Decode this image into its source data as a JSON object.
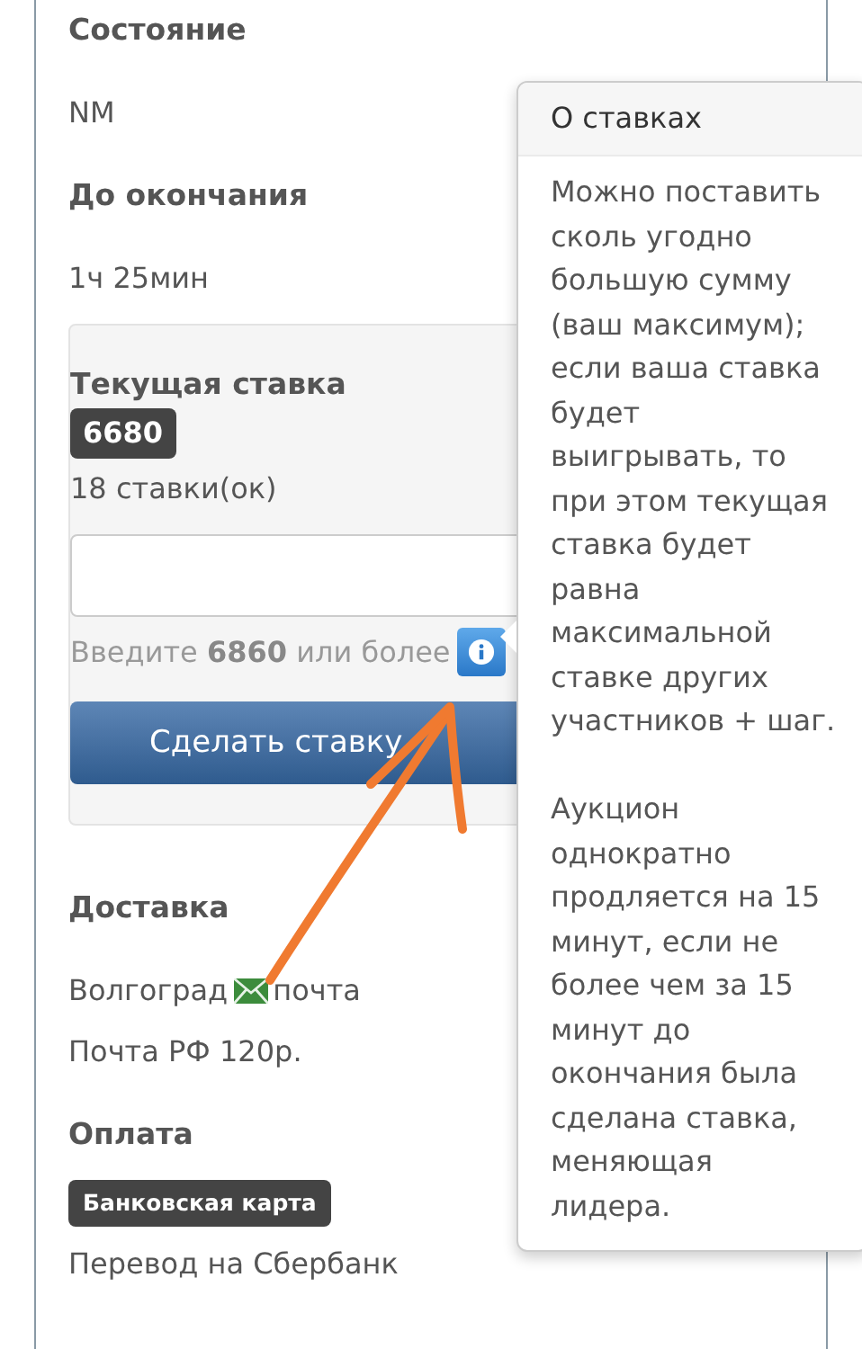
{
  "fields": [
    {
      "label": "Состояние",
      "value": "NM"
    },
    {
      "label": "До окончания",
      "value": "1ч 25мин"
    }
  ],
  "bid": {
    "title": "Текущая ставка",
    "amount": "6680",
    "count": "18 ставки(ок)",
    "hint": "Введите **6860** или более",
    "button": "Сделать ставку"
  },
  "delivery": {
    "title": "Доставка",
    "city": "Волгоград",
    "method": "почта",
    "cost": "Почта РФ 120р."
  },
  "payment": {
    "title": "Оплата",
    "badge": "Банковская карта",
    "method": "Перевод на Сбербанк"
  },
  "popover": {
    "title": "О ставках",
    "paragraphs": [
      "Можно поставить сколь угодно большую сумму (ваш максимум); если ваша ставка будет выигрывать, то при этом текущая ставка будет равна максимальной ставке других участников + шаг.",
      "Аукцион однократно продляется на 15 минут, если не более чем за 15 минут до окончания была сделана ставка, меняющая лидера."
    ]
  }
}
